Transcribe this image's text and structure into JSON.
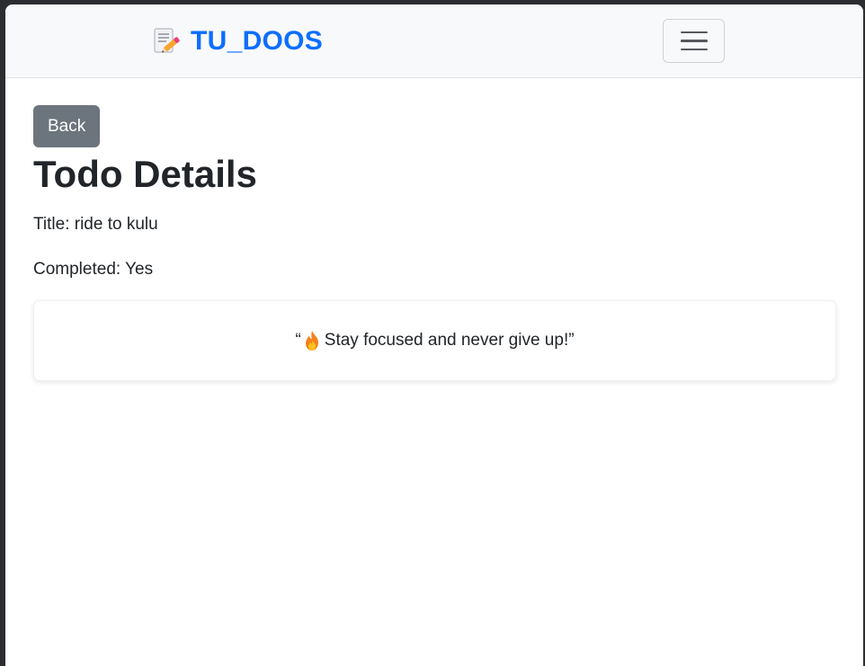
{
  "navbar": {
    "brand_icon": "memo-pencil-icon",
    "brand_text": "TU_DOOS",
    "brand_color": "#0d6efd",
    "toggler_icon": "hamburger-menu-icon"
  },
  "main": {
    "back_label": "Back",
    "heading": "Todo Details",
    "title_line": "Title: ride to kulu",
    "completed_line": "Completed: Yes",
    "quote": {
      "open_mark": "“",
      "icon": "fire-icon",
      "text": " Stay focused and never give up!",
      "close_mark": "”"
    }
  },
  "colors": {
    "back_button_bg": "#6c757d",
    "navbar_bg": "#f8f9fa",
    "text": "#212529"
  }
}
